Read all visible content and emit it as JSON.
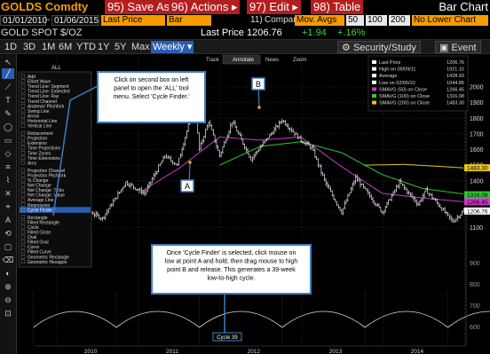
{
  "header": {
    "ticker": "GOLDS Comdty",
    "menus": [
      {
        "num": "95)",
        "label": "Save As"
      },
      {
        "num": "96)",
        "label": "Actions ▸"
      },
      {
        "num": "97)",
        "label": "Edit ▸"
      },
      {
        "num": "98)",
        "label": "Table"
      }
    ],
    "title": "Bar Chart"
  },
  "controls": {
    "start_date": "01/01/2010",
    "end_date": "01/06/2015",
    "price_field": "Last Price",
    "chart_type": "Bar",
    "compare_num": "11)",
    "compare_label": "Compar",
    "study": "Mov. Avgs",
    "ma_periods": [
      "50",
      "100",
      "200"
    ],
    "lower_chart": "No Lower Chart"
  },
  "quote": {
    "name": "GOLD SPOT $/OZ",
    "last_label": "Last Price",
    "last_value": "1206.76",
    "change": "+1.94",
    "change_pct": "+.16%"
  },
  "toolbar": {
    "periods": [
      "1D",
      "3D",
      "1M",
      "6M",
      "YTD",
      "1Y",
      "5Y",
      "Max"
    ],
    "active_period": "Weekly",
    "security_study": "Security/Study",
    "event": "Event"
  },
  "sidebar_tools": [
    "↖",
    "╱",
    "⟋",
    "T",
    "✎",
    "◯",
    "▭",
    "◇",
    "≡",
    "⌇",
    "✕",
    "⌖",
    "A",
    "⟲",
    "▢",
    "⌫",
    "◐",
    "⊕",
    "⊖",
    "⊡"
  ],
  "chart_toolbar": [
    "Track",
    "Annotate",
    "News",
    "Zoom"
  ],
  "drawing_menu": {
    "items": [
      "Add",
      "Elliott Wave",
      "Trend Line: Segment",
      "Trend Line: Extended",
      "Trend Line: Ray",
      "Trend Channel",
      "Andrews' Pitchfork",
      "Swing Line",
      "Arrow",
      "Horizontal Line",
      "Vertical Line",
      "Retracement",
      "Projection",
      "Extension",
      "Time Projections",
      "Time Zones",
      "Time Extensions",
      "Arcs",
      "Projection Channel",
      "Projection Pitchfork",
      "% Change",
      "Net Change",
      "Net Change: Ticks",
      "Net Change: Value",
      "Average Line",
      "Regression",
      "Cycle Finder",
      "Rectangle",
      "Filled Rectangle",
      "Circle",
      "Filled Circle",
      "Oval",
      "Filled Oval",
      "Curve",
      "Filled Curve",
      "Geometric Rectangle",
      "Geometric Hexagon"
    ],
    "selected": "Cycle Finder"
  },
  "legend": {
    "items": [
      {
        "label": "Last Price",
        "value": "1206.76",
        "color": "#ffffff"
      },
      {
        "label": "High on 09/09/11",
        "value": "1921.15",
        "color": "#ffffff"
      },
      {
        "label": "Average",
        "value": "1428.93",
        "color": "#ffffff"
      },
      {
        "label": "Low on 02/05/10",
        "value": "1044.85",
        "color": "#ffffff"
      },
      {
        "label": "SMAVG (50) on Close",
        "value": "1266.45",
        "color": "#c83cc8"
      },
      {
        "label": "SMAVG (100) on Close",
        "value": "1316.08",
        "color": "#2ec82e"
      },
      {
        "label": "SMAVG (200) on Close",
        "value": "1483.30",
        "color": "#e6c41e"
      }
    ]
  },
  "callouts": {
    "top": "Click on second box on left panel to open the 'ALL' tool menu. Select 'Cycle Finder.'",
    "bottom": "Once 'Cycle Finder' is selected, click mouse on low at point A and hold, then drag mouse to high point B and release. This generates a 39-week low-to-high cycle.",
    "cycle_label": "Cycle 39",
    "point_a": "A",
    "point_b": "B"
  },
  "chart_data": {
    "type": "bar",
    "title": "",
    "frequency": "weekly",
    "x_tick_labels": [
      "2010",
      "2011",
      "2012",
      "2013",
      "2014",
      "2015"
    ],
    "y_tick_labels": [
      "1100",
      "1200",
      "1300",
      "1400",
      "1500",
      "1600",
      "1700",
      "1800",
      "1900",
      "2000"
    ],
    "ylim": [
      1030,
      2040
    ],
    "axis_tags": [
      {
        "value": "1483.30",
        "color": "#e6c41e"
      },
      {
        "value": "1316.08",
        "color": "#2ec82e"
      },
      {
        "value": "1266.45",
        "color": "#c83cc8"
      },
      {
        "value": "1206.76",
        "color": "#ffffff"
      }
    ],
    "price_keypoints": [
      {
        "date": "2010-01-01",
        "value": 1100
      },
      {
        "date": "2010-02-05",
        "value": 1060
      },
      {
        "date": "2010-05-01",
        "value": 1220
      },
      {
        "date": "2010-07-23",
        "value": 1160
      },
      {
        "date": "2010-11-05",
        "value": 1390
      },
      {
        "date": "2011-01-28",
        "value": 1320
      },
      {
        "date": "2011-04-29",
        "value": 1560
      },
      {
        "date": "2011-06-24",
        "value": 1500
      },
      {
        "date": "2011-09-09",
        "value": 1900
      },
      {
        "date": "2011-09-30",
        "value": 1600
      },
      {
        "date": "2011-11-11",
        "value": 1780
      },
      {
        "date": "2011-12-30",
        "value": 1560
      },
      {
        "date": "2012-02-24",
        "value": 1780
      },
      {
        "date": "2012-05-18",
        "value": 1540
      },
      {
        "date": "2012-10-05",
        "value": 1790
      },
      {
        "date": "2012-12-28",
        "value": 1660
      },
      {
        "date": "2013-02-15",
        "value": 1610
      },
      {
        "date": "2013-04-19",
        "value": 1380
      },
      {
        "date": "2013-06-28",
        "value": 1200
      },
      {
        "date": "2013-08-30",
        "value": 1420
      },
      {
        "date": "2013-12-27",
        "value": 1200
      },
      {
        "date": "2014-03-14",
        "value": 1390
      },
      {
        "date": "2014-06-06",
        "value": 1250
      },
      {
        "date": "2014-07-11",
        "value": 1340
      },
      {
        "date": "2014-11-07",
        "value": 1140
      },
      {
        "date": "2014-12-26",
        "value": 1206
      }
    ],
    "sma50_keypoints": [
      {
        "date": "2010-12-31",
        "value": 1320
      },
      {
        "date": "2011-07-01",
        "value": 1480
      },
      {
        "date": "2011-12-30",
        "value": 1680
      },
      {
        "date": "2012-06-29",
        "value": 1660
      },
      {
        "date": "2012-12-28",
        "value": 1680
      },
      {
        "date": "2013-06-28",
        "value": 1490
      },
      {
        "date": "2013-12-27",
        "value": 1320
      },
      {
        "date": "2014-06-27",
        "value": 1290
      },
      {
        "date": "2014-12-26",
        "value": 1266
      }
    ],
    "sma100_keypoints": [
      {
        "date": "2011-12-30",
        "value": 1500
      },
      {
        "date": "2012-06-29",
        "value": 1620
      },
      {
        "date": "2012-12-28",
        "value": 1650
      },
      {
        "date": "2013-06-28",
        "value": 1580
      },
      {
        "date": "2013-12-27",
        "value": 1440
      },
      {
        "date": "2014-06-27",
        "value": 1350
      },
      {
        "date": "2014-12-26",
        "value": 1316
      }
    ],
    "sma200_keypoints": [
      {
        "date": "2013-10-04",
        "value": 1500
      },
      {
        "date": "2014-04-04",
        "value": 1505
      },
      {
        "date": "2014-12-26",
        "value": 1483
      }
    ],
    "cycle": {
      "label": "Cycle 39",
      "period_weeks": 39,
      "start_date": "2011-09-30",
      "end_date": "2012-10-05",
      "low_value": 1540,
      "high_value": 1790
    }
  }
}
